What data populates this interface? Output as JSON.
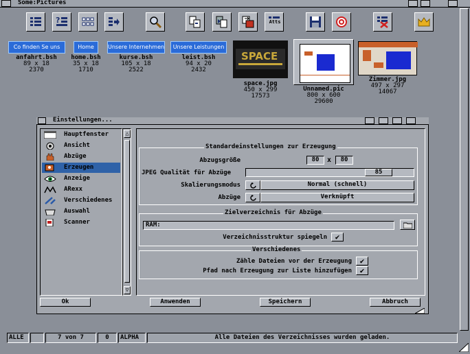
{
  "window": {
    "title": "Some:Pictures"
  },
  "toolbar": {
    "atts_label": "Atts"
  },
  "files": [
    {
      "button": "Co finden Se uns",
      "name": "anfahrt.bsh",
      "dims": "89 x 18",
      "size": "2370"
    },
    {
      "button": "Home",
      "name": "home.bsh",
      "dims": "35 x 18",
      "size": "1710"
    },
    {
      "button": "Unsere Internehmens",
      "name": "kurse.bsh",
      "dims": "105 x 18",
      "size": "2522"
    },
    {
      "button": "Unsere Leistungen",
      "name": "leist.bsh",
      "dims": "94 x 20",
      "size": "2432"
    },
    {
      "name": "space.jpg",
      "dims": "450 x 299",
      "size": "17573"
    },
    {
      "name": "Unnamed.pic",
      "dims": "800 x 600",
      "size": "29600"
    },
    {
      "name": "Zimmer.jpg",
      "dims": "497 x 297",
      "size": "14067"
    }
  ],
  "dialog": {
    "title": "Einstellungen...",
    "categories": [
      "Hauptfenster",
      "Ansicht",
      "Abzüge",
      "Erzeugen",
      "Anzeige",
      "ARexx",
      "Verschiedenes",
      "Auswahl",
      "Scanner"
    ],
    "selected": "Erzeugen",
    "group1": {
      "title": "Standardeinstellungen zur Erzeugung",
      "size_label": "Abzugsgröße",
      "width": "80",
      "x": "x",
      "height": "80",
      "jpeg_label": "JPEG Qualität für Abzüge",
      "jpeg_value": "85",
      "jpeg_quality": 85,
      "scale_label": "Skalierungsmodus",
      "scale_value": "Normal (schnell)",
      "thumbs_label": "Abzüge",
      "thumbs_value": "Verknüpft"
    },
    "group2": {
      "title": "Zielverzeichnis für Abzüge",
      "path": "RAM:",
      "mirror_label": "Verzeichnisstruktur spiegeln"
    },
    "group3": {
      "title": "Verschiedenes",
      "count_label": "Zähle Dateien vor der Erzeugung",
      "addpath_label": "Pfad nach Erzeugung zur Liste hinzufügen"
    },
    "buttons": {
      "ok": "Ok",
      "apply": "Anwenden",
      "save": "Speichern",
      "cancel": "Abbruch"
    }
  },
  "status": {
    "filter": "ALLE",
    "count": "7 von 7",
    "selected": "0",
    "mode": "ALPHA",
    "message": "Alle Dateien des Verzeichnisses wurden geladen."
  },
  "space_thumb_text": "SPACE"
}
